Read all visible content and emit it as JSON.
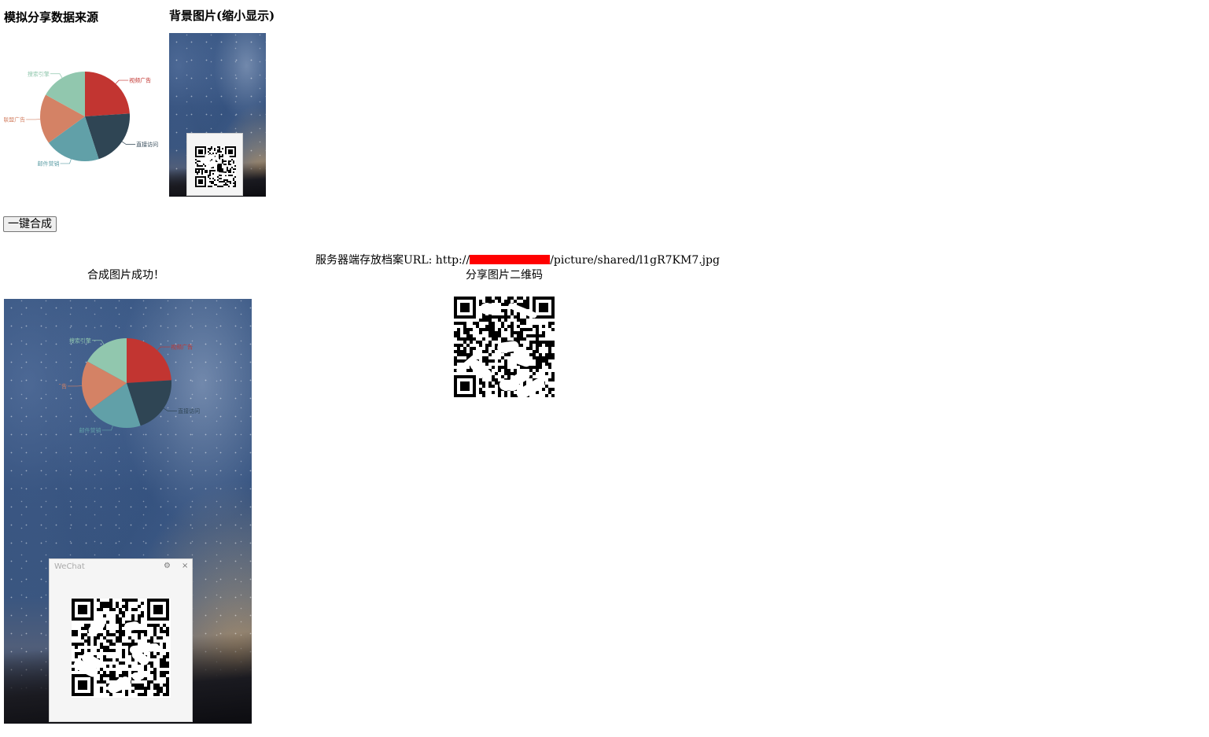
{
  "headings": {
    "data_source": "模拟分享数据来源",
    "background": "背景图片(缩小显示)"
  },
  "actions": {
    "merge_button": "一键合成"
  },
  "result": {
    "status": "合成图片成功！",
    "url_prefix": "服务器端存放档案URL: http://",
    "url_suffix": "/picture/shared/l1gR7KM7.jpg",
    "qr_caption": "分享图片二维码"
  },
  "wechat_window": {
    "title": "WeChat",
    "settings_icon": "gear-icon",
    "close_icon": "close-icon",
    "close_glyph": "×",
    "settings_glyph": "⚙"
  },
  "chart_data": {
    "type": "pie",
    "slices": [
      {
        "label": "视频广告",
        "value": 24,
        "color": "#c23531"
      },
      {
        "label": "直接访问",
        "value": 21,
        "color": "#2f4554"
      },
      {
        "label": "邮件营销",
        "value": 20,
        "color": "#61a0a8"
      },
      {
        "label": "联盟广告",
        "value": 18,
        "color": "#d48265"
      },
      {
        "label": "搜索引擎",
        "value": 17,
        "color": "#91c7ae"
      }
    ],
    "legend": "none"
  },
  "colors": {
    "redaction": "#ff0000",
    "button_bg": "#efefef"
  }
}
